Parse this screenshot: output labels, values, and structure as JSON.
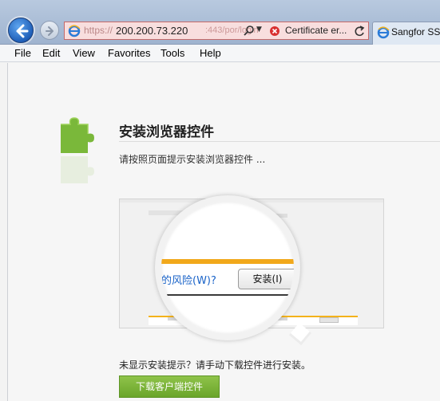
{
  "browser": {
    "address": {
      "url_prefix": "https://",
      "url_host": "200.200.73.220",
      "url_tail": ":443/por/login",
      "cert_error": "Certificate er..."
    },
    "tab": {
      "label": "Sangfor SS"
    }
  },
  "menu": [
    "File",
    "Edit",
    "View",
    "Favorites",
    "Tools",
    "Help"
  ],
  "page": {
    "title": "安装浏览器控件",
    "hint": "请按照页面提示安装浏览器控件 ...",
    "magnifier": {
      "risk_text": "的风险(W)?",
      "install_button": "安装(I)"
    },
    "notice": "未显示安装提示？请手动下载控件进行安装。",
    "download_button": "下载客户端控件"
  },
  "colors": {
    "accent_green": "#7ab83a",
    "address_error": "#f8dede",
    "bar_gold": "#f1a81b"
  }
}
